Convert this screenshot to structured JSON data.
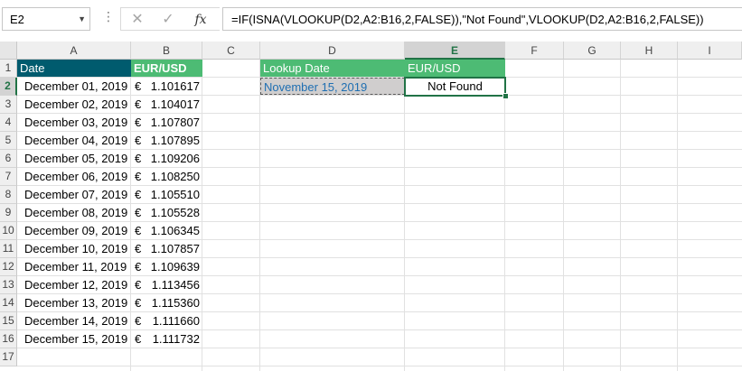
{
  "name_box": "E2",
  "formula": "=IF(ISNA(VLOOKUP(D2,A2:B16,2,FALSE)),\"Not Found\",VLOOKUP(D2,A2:B16,2,FALSE))",
  "fx_label": "fx",
  "columns": [
    "A",
    "B",
    "C",
    "D",
    "E",
    "F",
    "G",
    "H",
    "I"
  ],
  "rows": [
    "1",
    "2",
    "3",
    "4",
    "5",
    "6",
    "7",
    "8",
    "9",
    "10",
    "11",
    "12",
    "13",
    "14",
    "15",
    "16",
    "17"
  ],
  "headers": {
    "a1": "Date",
    "b1": "EUR/USD",
    "d1": "Lookup Date",
    "e1": "EUR/USD"
  },
  "currency_symbol": "€",
  "table": [
    {
      "date": "December 01, 2019",
      "rate": "1.101617"
    },
    {
      "date": "December 02, 2019",
      "rate": "1.104017"
    },
    {
      "date": "December 03, 2019",
      "rate": "1.107807"
    },
    {
      "date": "December 04, 2019",
      "rate": "1.107895"
    },
    {
      "date": "December 05, 2019",
      "rate": "1.109206"
    },
    {
      "date": "December 06, 2019",
      "rate": "1.108250"
    },
    {
      "date": "December 07, 2019",
      "rate": "1.105510"
    },
    {
      "date": "December 08, 2019",
      "rate": "1.105528"
    },
    {
      "date": "December 09, 2019",
      "rate": "1.106345"
    },
    {
      "date": "December 10, 2019",
      "rate": "1.107857"
    },
    {
      "date": "December 11, 2019",
      "rate": "1.109639"
    },
    {
      "date": "December 12, 2019",
      "rate": "1.113456"
    },
    {
      "date": "December 13, 2019",
      "rate": "1.115360"
    },
    {
      "date": "December 14, 2019",
      "rate": "1.111660"
    },
    {
      "date": "December 15, 2019",
      "rate": "1.111732"
    }
  ],
  "lookup_date": "November 15, 2019",
  "result": "Not Found",
  "colors": {
    "header_dark": "#005b6e",
    "header_green": "#4dbb74",
    "excel_green": "#217346",
    "lookup_text": "#1f6fb2"
  }
}
